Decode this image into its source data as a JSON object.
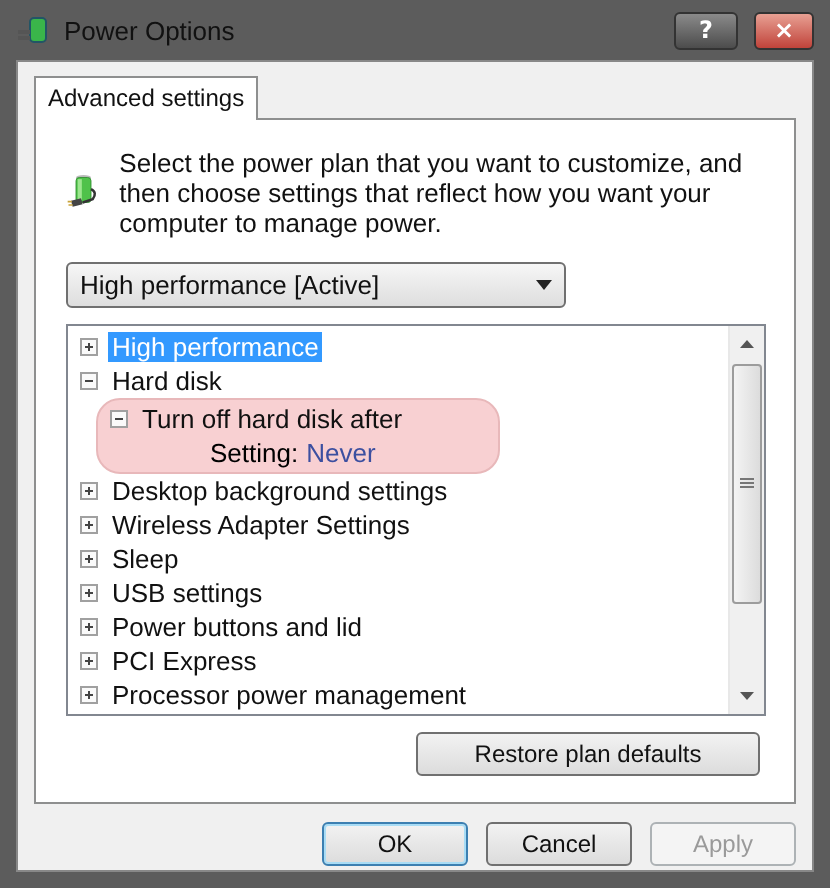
{
  "window": {
    "title": "Power Options",
    "help_button": "?",
    "close_button": "×"
  },
  "tabs": [
    {
      "label": "Advanced settings",
      "selected": true
    }
  ],
  "description": "Select the power plan that you want to customize, and then choose settings that reflect how you want your computer to manage power.",
  "plan_dropdown": {
    "value": "High performance [Active]"
  },
  "tree": [
    {
      "label": "High performance",
      "expanded": false,
      "selected": true,
      "highlighted": false
    },
    {
      "label": "Hard disk",
      "expanded": true,
      "selected": false,
      "highlighted": false,
      "children": [
        {
          "label": "Turn off hard disk after",
          "expanded": true,
          "selected": false,
          "highlighted": true,
          "setting": {
            "label": "Setting:",
            "value": "Never"
          }
        }
      ]
    },
    {
      "label": "Desktop background settings",
      "expanded": false,
      "selected": false,
      "highlighted": false
    },
    {
      "label": "Wireless Adapter Settings",
      "expanded": false,
      "selected": false,
      "highlighted": false
    },
    {
      "label": "Sleep",
      "expanded": false,
      "selected": false,
      "highlighted": false
    },
    {
      "label": "USB settings",
      "expanded": false,
      "selected": false,
      "highlighted": false
    },
    {
      "label": "Power buttons and lid",
      "expanded": false,
      "selected": false,
      "highlighted": false
    },
    {
      "label": "PCI Express",
      "expanded": false,
      "selected": false,
      "highlighted": false
    },
    {
      "label": "Processor power management",
      "expanded": false,
      "selected": false,
      "highlighted": false
    }
  ],
  "restore_button": "Restore plan defaults",
  "buttons": [
    {
      "label": "OK",
      "disabled": false,
      "default": true
    },
    {
      "label": "Cancel",
      "disabled": false,
      "default": false
    },
    {
      "label": "Apply",
      "disabled": true,
      "default": false
    }
  ]
}
